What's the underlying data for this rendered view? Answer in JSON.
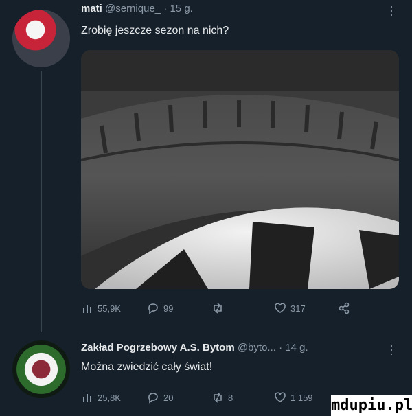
{
  "tweet1": {
    "display_name": "mati",
    "handle": "@sernique_",
    "separator": "·",
    "age": "15 g.",
    "text": "Zrobię jeszcze sezon na nich?",
    "photo_icon": "tire-photo",
    "stats": {
      "views": "55,9K",
      "replies": "99",
      "retweets": "",
      "likes": "317"
    }
  },
  "tweet2": {
    "display_name": "Zakład Pogrzebowy A.S. Bytom",
    "handle": "@byto...",
    "separator": "·",
    "age": "14 g.",
    "text": "Można zwiedzić cały świat!",
    "stats": {
      "views": "25,8K",
      "replies": "20",
      "retweets": "8",
      "likes": "1 159"
    }
  },
  "watermark": "mdupiu.pl",
  "colors": {
    "background": "#15202b",
    "text": "#e7e9ea",
    "muted": "#8b98a5",
    "thread_line": "#38444d"
  }
}
